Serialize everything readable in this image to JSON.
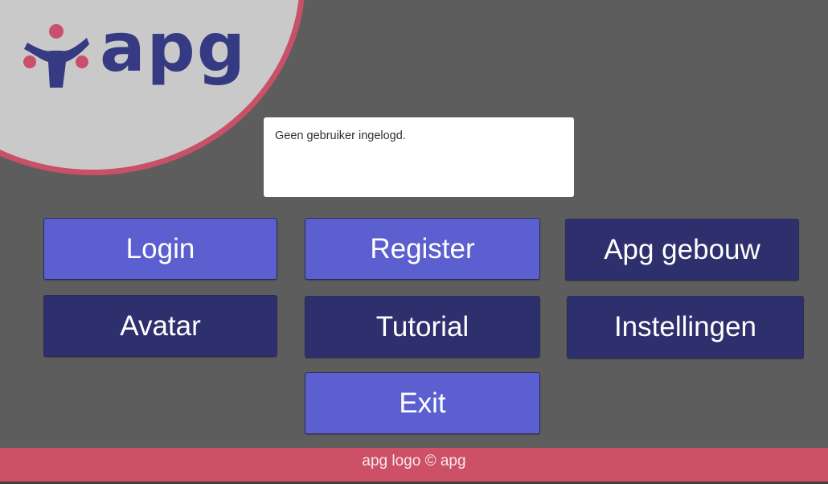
{
  "logo": {
    "text": "apg",
    "mark_icon": "apg-figure-logo-icon"
  },
  "status": {
    "message": "Geen gebruiker ingelogd."
  },
  "buttons": {
    "login": "Login",
    "register": "Register",
    "apg_gebouw": "Apg gebouw",
    "avatar": "Avatar",
    "tutorial": "Tutorial",
    "instellingen": "Instellingen",
    "exit": "Exit"
  },
  "footer": {
    "text": "apg logo © apg"
  },
  "colors": {
    "background": "#5d5d5d",
    "logo_disc": "#c9c9c9",
    "accent_pink": "#cc5066",
    "button_light": "#5c5fcf",
    "button_dark": "#2e2f6d",
    "brand_navy": "#363a82"
  }
}
